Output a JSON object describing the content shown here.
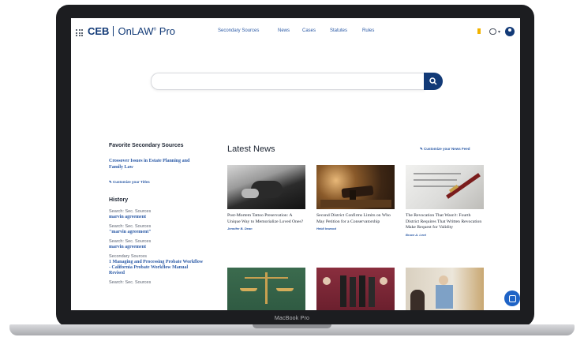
{
  "device": {
    "model_label": "MacBook Pro"
  },
  "header": {
    "logo_ceb": "CEB",
    "logo_product": "OnLAW",
    "logo_reg": "®",
    "logo_pro": "Pro",
    "nav": [
      "Secondary Sources",
      "News",
      "Cases",
      "Statutes",
      "Rules"
    ],
    "icons": [
      "apps-grid-icon",
      "bookmark-icon",
      "chat-icon",
      "account-icon"
    ]
  },
  "search": {
    "placeholder": "",
    "button_icon": "search-icon"
  },
  "favorites": {
    "title": "Favorite Secondary Sources",
    "items": [
      "Crossover Issues in Estate Planning and Family Law"
    ],
    "customize_label": "Customize your Titles"
  },
  "history": {
    "title": "History",
    "items": [
      {
        "type": "Search: Sec. Sources",
        "query": "marvin agreement"
      },
      {
        "type": "Search: Sec. Sources",
        "query": "\"marvin agreement\""
      },
      {
        "type": "Search: Sec. Sources",
        "query": "marvin agreement"
      },
      {
        "type": "Secondary Sources",
        "query": "1 Managing and Processing Probate Workflow - California Probate Workflow Manual Revised"
      },
      {
        "type": "Search: Sec. Sources",
        "query": ""
      }
    ]
  },
  "news": {
    "title": "Latest News",
    "customize_label": "Customize your News Feed",
    "cards": [
      {
        "title": "Post-Mortem Tattoo Preservation: A Unique Way to Memorialize Loved Ones?",
        "author": "Jennifer B. Dean",
        "image": "tattoo-photo"
      },
      {
        "title": "Second District Confirms Limits on Who May Petition for a Conservatorship",
        "author": "Heidi Inwood",
        "image": "gavel-photo"
      },
      {
        "title": "The Revocation That Wasn't: Fourth District Requires That Written Revocation Make Request for Validity",
        "author": "Bruce A. Lent",
        "image": "document-pen-photo"
      },
      {
        "title": "",
        "author": "",
        "image": "scales-photo"
      },
      {
        "title": "",
        "author": "",
        "image": "group-photo"
      },
      {
        "title": "",
        "author": "",
        "image": "meeting-photo"
      }
    ]
  },
  "colors": {
    "brand": "#123a77",
    "link": "#2b5aa6",
    "fab": "#1e63c6"
  }
}
